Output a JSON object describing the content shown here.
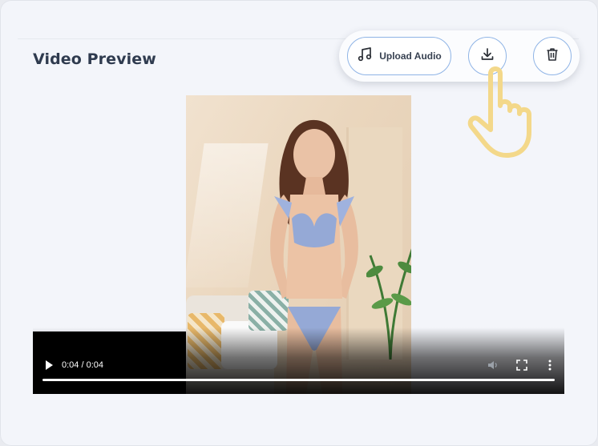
{
  "panel": {
    "title": "Video Preview"
  },
  "toolbar": {
    "upload_label": "Upload Audio",
    "upload_icon": "music-note-icon",
    "download_icon": "download-icon",
    "delete_icon": "trash-icon",
    "border_color": "#8fb4e6"
  },
  "video": {
    "time_display": "0:04 / 0:04",
    "progress": 1.0,
    "controls": [
      "play-icon",
      "volume-icon",
      "fullscreen-icon",
      "more-options-icon"
    ]
  },
  "overlay": {
    "pointer_icon": "pointing-hand-icon",
    "color": "#f3d88a"
  }
}
